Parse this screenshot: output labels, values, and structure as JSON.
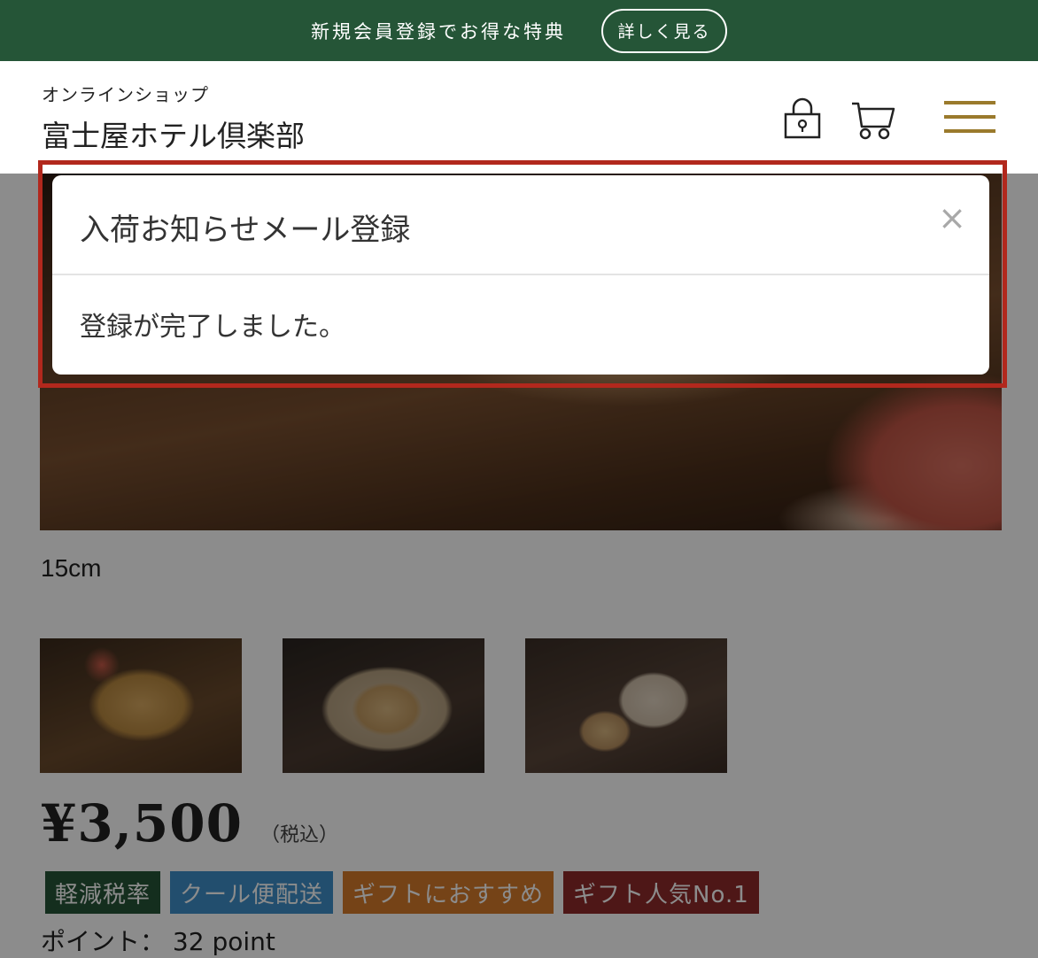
{
  "promo": {
    "text": "新規会員登録でお得な特典",
    "button_label": "詳しく見る"
  },
  "header": {
    "subtitle": "オンラインショップ",
    "shop_name": "富士屋ホテル倶楽部",
    "icons": [
      "lock-icon",
      "cart-icon",
      "hamburger-menu-icon"
    ],
    "accent_color": "#9a7a2c"
  },
  "modal": {
    "title": "入荷お知らせメール登録",
    "close_glyph": "×",
    "message": "登録が完了しました。",
    "highlight_color": "#b2281d"
  },
  "product": {
    "size": "15cm",
    "thumbnails": [
      "thumbnail-apple-pie-cut",
      "thumbnail-pie-in-box",
      "thumbnail-pie-with-box"
    ],
    "price": "¥3,500",
    "tax_note": "（税込）",
    "badges": [
      {
        "label": "軽減税率",
        "color": "#255537"
      },
      {
        "label": "クール便配送",
        "color": "#3e8fc8"
      },
      {
        "label": "ギフトにおすすめ",
        "color": "#d67a2a"
      },
      {
        "label": "ギフト人気No.1",
        "color": "#8f2a2a"
      }
    ],
    "points_label": "ポイント：",
    "points_value": "32 point"
  },
  "colors": {
    "banner_bg": "#255537",
    "overlay": "rgba(0,0,0,0.45)"
  }
}
